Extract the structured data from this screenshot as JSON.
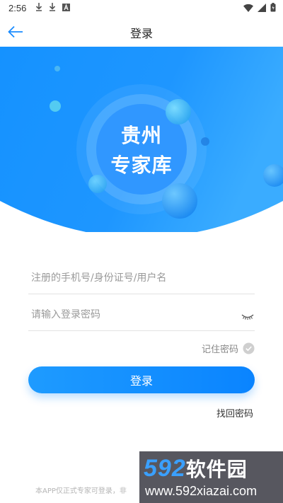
{
  "status_bar": {
    "time": "2:56",
    "left_icons": [
      "download-icon",
      "download-icon",
      "font-icon"
    ],
    "right_icons": [
      "wifi-icon",
      "signal-icon",
      "battery-icon"
    ]
  },
  "nav": {
    "title": "登录",
    "back_icon": "back-arrow-icon",
    "accent_color": "#1a8cff"
  },
  "hero": {
    "logo_line1": "贵州",
    "logo_line2": "专家库",
    "colors": {
      "primary": "#1a8cff",
      "light": "#3fb0ff",
      "bubble": "#5ad0f0"
    }
  },
  "form": {
    "username_placeholder": "注册的手机号/身份证号/用户名",
    "username_value": "",
    "password_placeholder": "请输入登录密码",
    "password_value": "",
    "password_icon": "eye-closed-icon",
    "remember_label": "记住密码",
    "remember_icon": "check-circle-icon",
    "login_label": "登录",
    "forgot_label": "找回密码"
  },
  "footer": {
    "note": "本APP仅正式专家可登录，非"
  },
  "watermark": {
    "brand_digits": "592",
    "brand_cn": "软件园",
    "url": "www.592xiazai.com"
  }
}
